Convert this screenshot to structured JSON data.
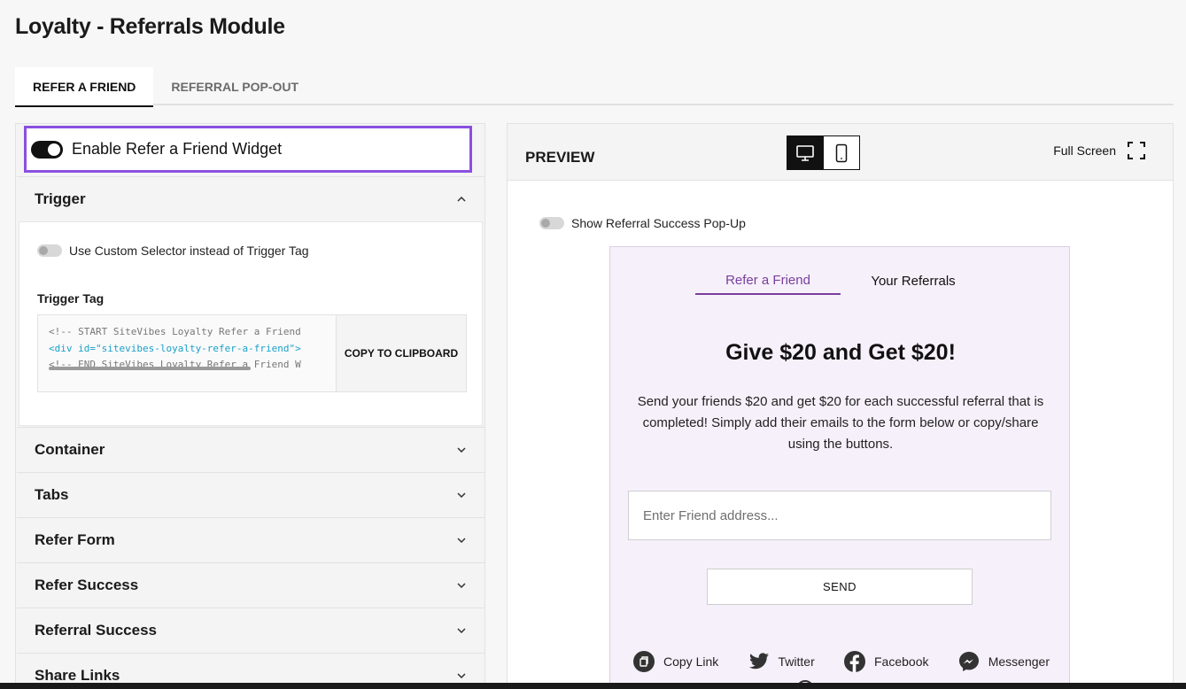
{
  "page": {
    "title": "Loyalty - Referrals Module"
  },
  "tabs": [
    {
      "label": "REFER A FRIEND",
      "active": true
    },
    {
      "label": "REFERRAL POP-OUT",
      "active": false
    }
  ],
  "left_panel": {
    "enable_label": "Enable Refer a Friend Widget",
    "enable_on": true,
    "trigger": {
      "title": "Trigger",
      "expanded": true,
      "custom_selector_label": "Use Custom Selector instead of Trigger Tag",
      "custom_selector_on": false,
      "trigger_tag_label": "Trigger Tag",
      "code_lines": [
        "<!-- START SiteVibes Loyalty Refer a Friend",
        "<div id=\"sitevibes-loyalty-refer-a-friend\">",
        "<!-- END SiteVibes Loyalty Refer a Friend W"
      ],
      "copy_label": "COPY TO CLIPBOARD"
    },
    "sections": [
      {
        "title": "Container"
      },
      {
        "title": "Tabs"
      },
      {
        "title": "Refer Form"
      },
      {
        "title": "Refer Success"
      },
      {
        "title": "Referral Success"
      },
      {
        "title": "Share Links"
      }
    ]
  },
  "preview": {
    "label": "PREVIEW",
    "device": {
      "active": "desktop",
      "icons": [
        "desktop-icon",
        "mobile-icon"
      ]
    },
    "fullscreen_label": "Full Screen",
    "popup_toggle_label": "Show Referral Success Pop-Up",
    "popup_toggle_on": false,
    "widget": {
      "tabs": [
        {
          "label": "Refer a Friend",
          "active": true
        },
        {
          "label": "Your Referrals",
          "active": false
        }
      ],
      "headline": "Give $20 and Get $20!",
      "description": "Send your friends $20 and get $20 for each successful referral that is completed! Simply add their emails to the form below or copy/share using the buttons.",
      "input_placeholder": "Enter Friend address...",
      "send_label": "SEND",
      "share": [
        {
          "label": "Copy Link",
          "icon": "copy-link-icon"
        },
        {
          "label": "Twitter",
          "icon": "twitter-icon"
        },
        {
          "label": "Facebook",
          "icon": "facebook-icon"
        },
        {
          "label": "Messenger",
          "icon": "messenger-icon"
        }
      ]
    }
  },
  "colors": {
    "accent": "#8a4fe0",
    "widget_tab_active": "#7a3f9d",
    "widget_bg": "#f6f0fa",
    "code_highlight": "#1aa0c8"
  }
}
